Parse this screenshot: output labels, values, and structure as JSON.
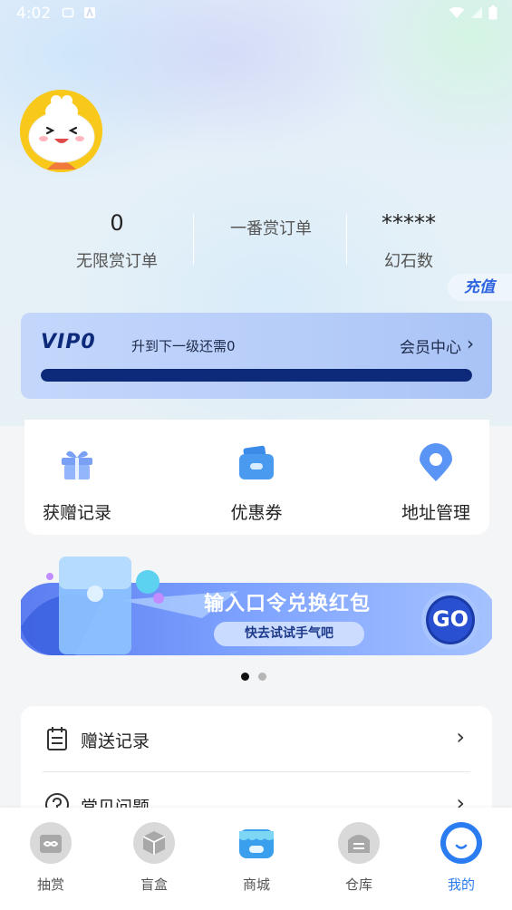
{
  "status_bar": {
    "time": "4:02"
  },
  "stats": [
    {
      "value": "0",
      "label": "无限赏订单"
    },
    {
      "value": "",
      "label": "一番赏订单"
    },
    {
      "value": "*****",
      "label": "幻石数"
    }
  ],
  "recharge_label": "充值",
  "vip": {
    "level": "VIP0",
    "next_level_text": "升到下一级还需0",
    "member_center_label": "会员中心",
    "progress": 1.0
  },
  "quick_actions": [
    {
      "label": "获赠记录",
      "icon": "gift-icon"
    },
    {
      "label": "优惠券",
      "icon": "wallet-icon"
    },
    {
      "label": "地址管理",
      "icon": "location-pin-icon"
    }
  ],
  "banner": {
    "title": "输入口令兑换红包",
    "button_label": "快去试试手气吧",
    "go_label": "GO"
  },
  "carousel": {
    "count": 2,
    "active_index": 0
  },
  "menu_list": [
    {
      "label": "赠送记录",
      "icon": "calendar-list-icon"
    },
    {
      "label": "常见问题",
      "icon": "question-circle-icon"
    }
  ],
  "tabs": [
    {
      "label": "抽赏",
      "icon": "infinity-box-icon",
      "active": false
    },
    {
      "label": "盲盒",
      "icon": "cube-icon",
      "active": false
    },
    {
      "label": "商城",
      "icon": "store-icon",
      "active": false
    },
    {
      "label": "仓库",
      "icon": "warehouse-icon",
      "active": false
    },
    {
      "label": "我的",
      "icon": "smile-face-icon",
      "active": true
    }
  ],
  "colors": {
    "accent": "#2b7cf0",
    "vip_dark": "#0d2a7a",
    "vip_bg": "#b6cdf9",
    "avatar_bg": "#f8c91a"
  }
}
